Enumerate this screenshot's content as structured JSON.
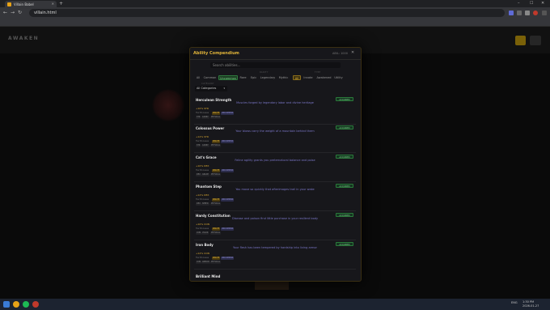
{
  "browser": {
    "tab_title": "Villain Babel",
    "tab_close": "✕",
    "new_tab": "+",
    "url": "villain.html",
    "window_controls": [
      "–",
      "☐",
      "✕"
    ]
  },
  "page": {
    "header_title": "AWAKEN"
  },
  "modal": {
    "title": "Ability Compendium",
    "count": "ABIL: 1000",
    "close": "✕",
    "search_placeholder": "Search abilities...",
    "rarity_label": "RARITY",
    "type_label": "TYPE",
    "category_label": "CATEGORY",
    "filters": [
      {
        "label": "All",
        "state": "none"
      },
      {
        "label": "Common",
        "state": "none"
      },
      {
        "label": "Uncommon",
        "state": "green"
      },
      {
        "label": "Rare",
        "state": "none"
      },
      {
        "label": "Epic",
        "state": "none"
      },
      {
        "label": "Legendary",
        "state": "none"
      },
      {
        "label": "Mythic",
        "state": "none"
      },
      {
        "label": "All",
        "state": "yellow"
      },
      {
        "label": "Innate",
        "state": "none"
      },
      {
        "label": "Awakened",
        "state": "none"
      },
      {
        "label": "Utility",
        "state": "none"
      }
    ],
    "category_value": "All Categories",
    "abilities": [
      {
        "name": "Herculean Strength",
        "effect": "Muscles forged by legendary labor and divine heritage",
        "cost": "+10% STR",
        "meta": "Tier Bonuses",
        "tag1": "INNATE",
        "tag2": "UNCOMMON",
        "tags": [
          "STR",
          "CARRY",
          "PHYSICAL"
        ],
        "action": "ACQUIRED"
      },
      {
        "name": "Colossus Power",
        "effect": "Your blows carry the weight of a mountain behind them",
        "cost": "+12% STR",
        "meta": "Tier Bonuses",
        "tag1": "INNATE",
        "tag2": "UNCOMMON",
        "tags": [
          "STR",
          "CARRY",
          "PHYSICAL"
        ],
        "action": "ACQUIRED"
      },
      {
        "name": "Cat's Grace",
        "effect": "Feline agility grants you preternatural balance and poise",
        "cost": "+10% DEX",
        "meta": "Tier Bonuses",
        "tag1": "INNATE",
        "tag2": "UNCOMMON",
        "tags": [
          "DEX",
          "GRACE",
          "PHYSICAL"
        ],
        "action": "ACQUIRED"
      },
      {
        "name": "Phantom Step",
        "effect": "You move so quickly that afterimages trail in your wake",
        "cost": "+12% DEX",
        "meta": "Tier Bonuses",
        "tag1": "INNATE",
        "tag2": "UNCOMMON",
        "tags": [
          "DEX",
          "SPEED",
          "PHYSICAL"
        ],
        "action": "ACQUIRED"
      },
      {
        "name": "Hardy Constitution",
        "effect": "Disease and poison find little purchase in your resilient body",
        "cost": "+10% CON",
        "meta": "Tier Bonuses",
        "tag1": "INNATE",
        "tag2": "UNCOMMON",
        "tags": [
          "CON",
          "VIGOR",
          "PHYSICAL"
        ],
        "action": "ACQUIRED"
      },
      {
        "name": "Iron Body",
        "effect": "Your flesh has been tempered by hardship into living armor",
        "cost": "+12% CON",
        "meta": "Tier Bonuses",
        "tag1": "INNATE",
        "tag2": "UNCOMMON",
        "tags": [
          "CON",
          "ARMOR",
          "PHYSICAL"
        ],
        "action": "ACQUIRED"
      }
    ],
    "last_name": "Brilliant Mind"
  },
  "taskbar": {
    "time": "1:30 PM",
    "date": "2026-01-27",
    "lang": "ENG"
  },
  "colors": {
    "accent": "#e2b53a",
    "uncommon": "#2f7a3d",
    "effect_text": "#7b77c8"
  }
}
